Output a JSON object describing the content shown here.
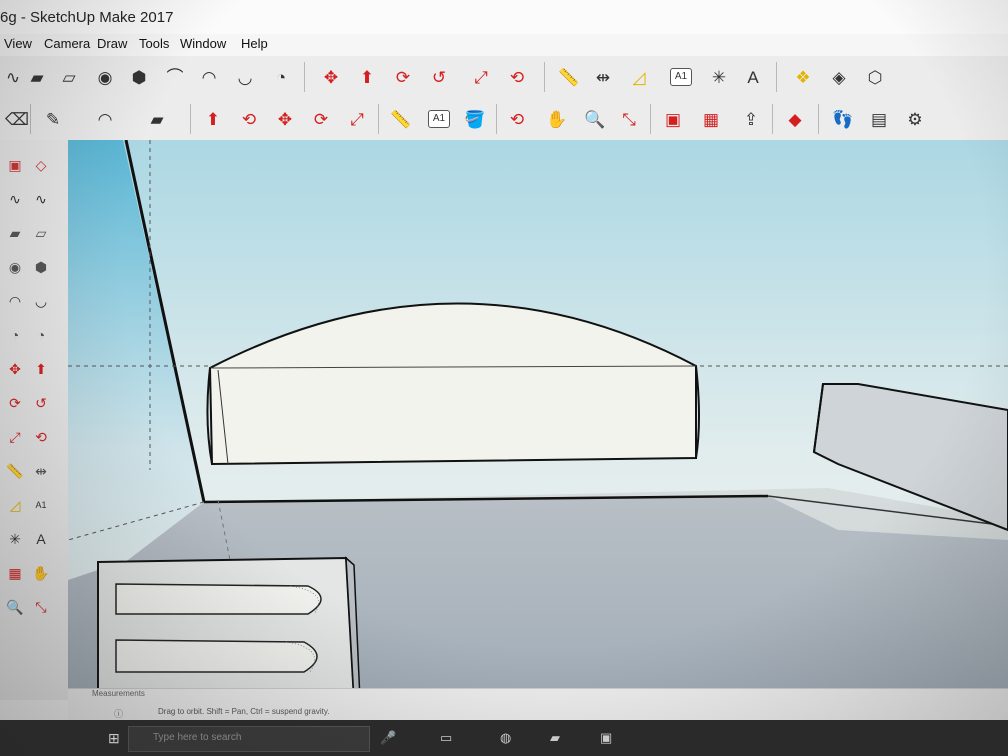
{
  "window": {
    "title": "6g - SketchUp Make 2017"
  },
  "menu": {
    "items": [
      "View",
      "Camera",
      "Draw",
      "Tools",
      "Window",
      "Help"
    ]
  },
  "toolbar1": {
    "tools": [
      {
        "name": "freehand",
        "glyph": "∿"
      },
      {
        "name": "rectangle",
        "glyph": "▰"
      },
      {
        "name": "rotated-rectangle",
        "glyph": "▱"
      },
      {
        "name": "circle",
        "glyph": "◉"
      },
      {
        "name": "polygon",
        "glyph": "⬢"
      },
      {
        "name": "arc",
        "glyph": "⌒"
      },
      {
        "name": "2-point-arc",
        "glyph": "◠"
      },
      {
        "name": "3-point-arc",
        "glyph": "◡"
      },
      {
        "name": "pie",
        "glyph": "◔"
      },
      {
        "name": "move",
        "glyph": "✥"
      },
      {
        "name": "push-pull",
        "glyph": "⬆"
      },
      {
        "name": "rotate",
        "glyph": "⟳"
      },
      {
        "name": "follow-me",
        "glyph": "↺"
      },
      {
        "name": "scale",
        "glyph": "⤢"
      },
      {
        "name": "offset",
        "glyph": "⟲"
      },
      {
        "name": "tape-measure",
        "glyph": "📏"
      },
      {
        "name": "dimension",
        "glyph": "⇹"
      },
      {
        "name": "protractor",
        "glyph": "◿"
      },
      {
        "name": "text",
        "glyph": "A1"
      },
      {
        "name": "axes",
        "glyph": "✳"
      },
      {
        "name": "3d-text",
        "glyph": "A"
      },
      {
        "name": "solid-union",
        "glyph": "❖"
      },
      {
        "name": "solid-subtract",
        "glyph": "◈"
      },
      {
        "name": "solid-intersect",
        "glyph": "⬡"
      }
    ]
  },
  "toolbar2": {
    "tools": [
      {
        "name": "eraser",
        "glyph": "⌫"
      },
      {
        "name": "line",
        "glyph": "✎"
      },
      {
        "name": "arc",
        "glyph": "◠"
      },
      {
        "name": "shapes",
        "glyph": "▰"
      },
      {
        "name": "push-pull",
        "glyph": "⬆"
      },
      {
        "name": "offset",
        "glyph": "⟲"
      },
      {
        "name": "move",
        "glyph": "✥"
      },
      {
        "name": "rotate",
        "glyph": "⟳"
      },
      {
        "name": "scale",
        "glyph": "⤢"
      },
      {
        "name": "tape-measure",
        "glyph": "📏"
      },
      {
        "name": "text",
        "glyph": "A1"
      },
      {
        "name": "paint-bucket",
        "glyph": "🪣"
      },
      {
        "name": "orbit",
        "glyph": "⟲"
      },
      {
        "name": "pan",
        "glyph": "✋"
      },
      {
        "name": "zoom",
        "glyph": "🔍"
      },
      {
        "name": "zoom-extents",
        "glyph": "⤡"
      },
      {
        "name": "3d-warehouse",
        "glyph": "▣"
      },
      {
        "name": "extension-warehouse",
        "glyph": "▦"
      },
      {
        "name": "share-model",
        "glyph": "⇪"
      },
      {
        "name": "extension-manager",
        "glyph": "◆"
      },
      {
        "name": "walk",
        "glyph": "👣"
      },
      {
        "name": "layout",
        "glyph": "▤"
      },
      {
        "name": "settings",
        "glyph": "⚙"
      }
    ]
  },
  "left_toolbar": {
    "count": 28
  },
  "status": {
    "measurements_label": "Measurements",
    "hint": "Drag to orbit. Shift = Pan, Ctrl = suspend gravity."
  },
  "taskbar": {
    "search_placeholder": "Type here to search"
  },
  "colors": {
    "sky_top": "#5ab7d6",
    "sky_bottom": "#f2f5f2",
    "ground": "#a9b3bd",
    "tool_red": "#d41f1f",
    "tool_yellow": "#e0b400"
  }
}
